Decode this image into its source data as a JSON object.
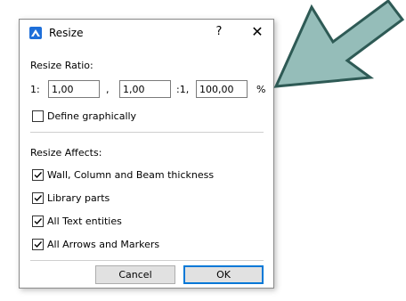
{
  "dialog": {
    "title": "Resize",
    "help_label": "?",
    "close_label": "✕",
    "icon": "archicad-app-icon"
  },
  "ratio": {
    "heading": "Resize Ratio:",
    "prefix": "1:",
    "x_value": "1,00",
    "comma": ",",
    "y_value": "1,00",
    "suffix_ratio": ":1,",
    "percent_value": "100,00",
    "percent_sign": "%"
  },
  "define_graphically": {
    "label": "Define graphically",
    "checked": false
  },
  "affects": {
    "heading": "Resize Affects:",
    "items": [
      {
        "label": "Wall, Column and Beam thickness",
        "checked": true
      },
      {
        "label": "Library parts",
        "checked": true
      },
      {
        "label": "All Text entities",
        "checked": true
      },
      {
        "label": "All Arrows and Markers",
        "checked": true
      }
    ]
  },
  "buttons": {
    "cancel": "Cancel",
    "ok": "OK"
  },
  "colors": {
    "annotation_arrow_fill": "#95bdb9",
    "annotation_arrow_stroke": "#2e5a55",
    "ok_border": "#0078d7",
    "app_icon": "#1e6fd9"
  }
}
